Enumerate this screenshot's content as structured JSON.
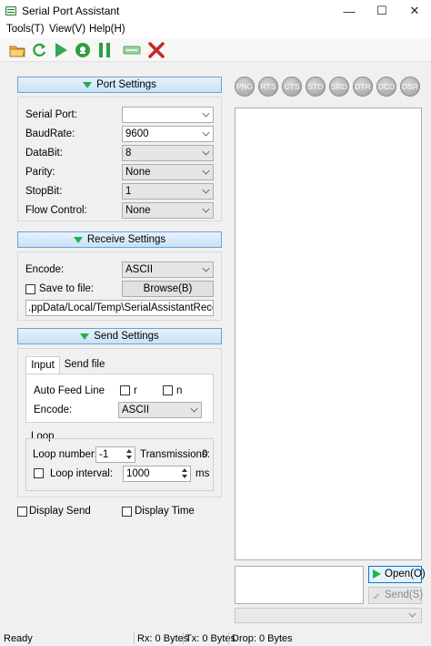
{
  "window": {
    "title": "Serial Port Assistant"
  },
  "menu": [
    "Tools(T)",
    "View(V)",
    "Help(H)"
  ],
  "port_settings": {
    "header": "Port Settings",
    "serial_port_label": "Serial Port:",
    "serial_port_value": "",
    "baudrate_label": "BaudRate:",
    "baudrate_value": "9600",
    "databit_label": "DataBit:",
    "databit_value": "8",
    "parity_label": "Parity:",
    "parity_value": "None",
    "stopbit_label": "StopBit:",
    "stopbit_value": "1",
    "flow_label": "Flow Control:",
    "flow_value": "None"
  },
  "receive_settings": {
    "header": "Receive Settings",
    "encode_label": "Encode:",
    "encode_value": "ASCII",
    "save_label": "Save to file:",
    "browse_label": "Browse(B)",
    "file_path": ".ppData/Local/Temp\\SerialAssistantReceive.txt"
  },
  "send_settings": {
    "header": "Send Settings",
    "tabs": [
      "Input",
      "Send file"
    ],
    "auto_feed_label": "Auto Feed Line",
    "r_label": "r",
    "n_label": "n",
    "encode_label": "Encode:",
    "encode_value": "ASCII",
    "loop_title": "Loop",
    "loop_number_label": "Loop number:",
    "loop_number_value": "-1",
    "transmissions_label": "Transmissions:",
    "transmissions_value": "0",
    "loop_interval_label": "Loop interval:",
    "loop_interval_value": "1000",
    "loop_interval_unit": "ms"
  },
  "display": {
    "send_label": "Display Send",
    "time_label": "Display Time"
  },
  "signals": [
    "PNG",
    "RTS",
    "CTS",
    "STD",
    "SRD",
    "DTR",
    "DCD",
    "DSR"
  ],
  "buttons": {
    "open": "Open(O)",
    "send": "Send(S)"
  },
  "status": {
    "ready": "Ready",
    "rx": "Rx: 0 Bytes",
    "tx": "Tx: 0 Bytes",
    "drop": "Drop: 0 Bytes"
  },
  "colors": {
    "header_bg": "#c9e2f7",
    "header_border": "#6ea2cf",
    "accent_green": "#22b14c",
    "close_red": "#c62828"
  },
  "icons": [
    "open-folder-icon",
    "refresh-icon",
    "play-icon",
    "record-icon",
    "pause-icon",
    "clear-icon",
    "close-icon"
  ]
}
